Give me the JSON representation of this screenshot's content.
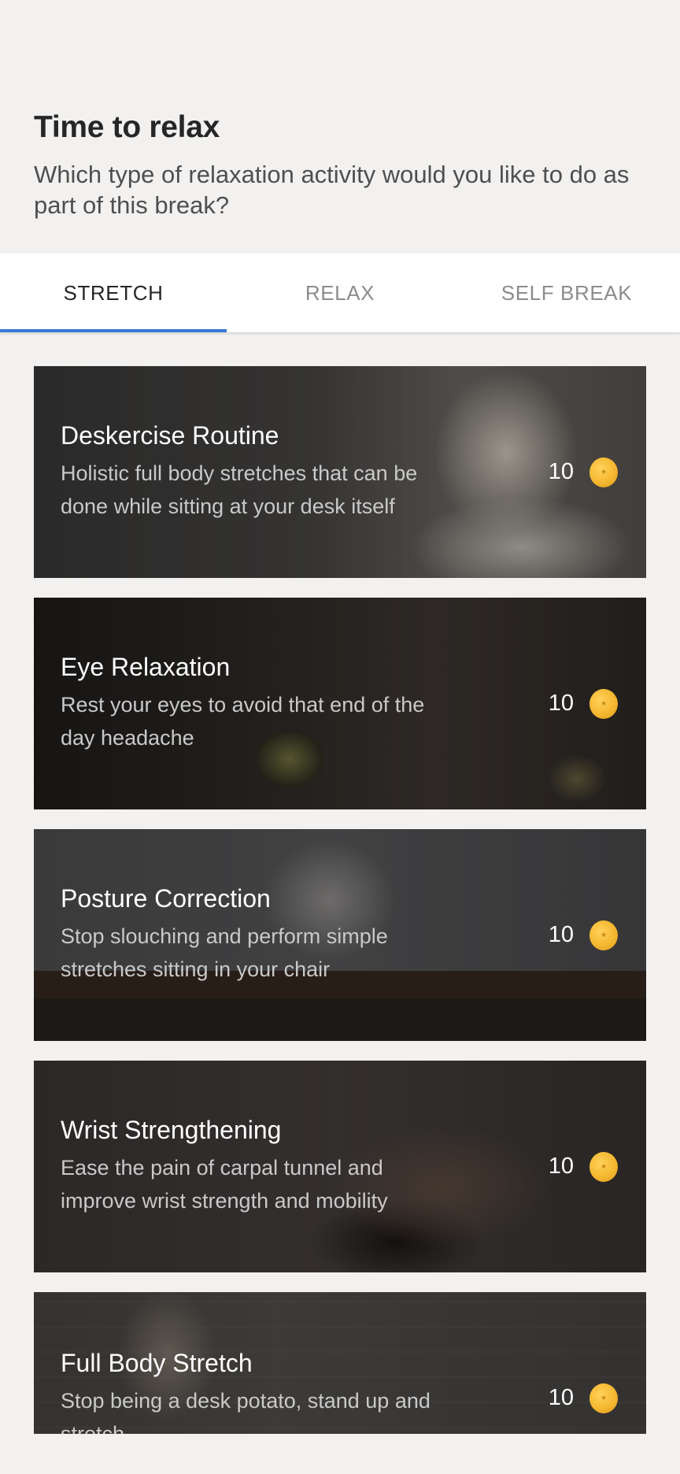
{
  "header": {
    "title": "Time to relax",
    "subtitle": "Which type of relaxation activity would you like to do as part of this break?"
  },
  "tabs": [
    {
      "label": "STRETCH",
      "active": true
    },
    {
      "label": "RELAX",
      "active": false
    },
    {
      "label": "SELF BREAK",
      "active": false
    }
  ],
  "accent_color": "#3b78d8",
  "coin_color": "#f5b731",
  "activities": [
    {
      "title": "Deskercise Routine",
      "description": "Holistic full body stretches that can be done while sitting at your desk itself",
      "points": "10"
    },
    {
      "title": "Eye Relaxation",
      "description": "Rest your eyes to avoid that end of the day headache",
      "points": "10"
    },
    {
      "title": "Posture Correction",
      "description": "Stop slouching and perform simple stretches sitting in your chair",
      "points": "10"
    },
    {
      "title": "Wrist Strengthening",
      "description": "Ease the pain of carpal tunnel and improve wrist strength and mobility",
      "points": "10"
    },
    {
      "title": "Full Body Stretch",
      "description": "Stop being a desk potato, stand up and stretch",
      "points": "10"
    }
  ]
}
